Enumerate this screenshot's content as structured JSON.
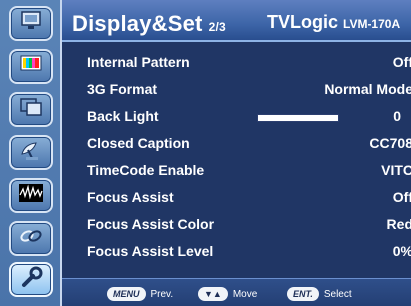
{
  "header": {
    "title": "Display&Set",
    "page": "2/3",
    "brand": "TVLogic",
    "model": "LVM-170A"
  },
  "sidebar": {
    "items": [
      {
        "icon": "monitor-icon",
        "active": false
      },
      {
        "icon": "color-bars-icon",
        "active": false
      },
      {
        "icon": "picture-in-picture-icon",
        "active": false
      },
      {
        "icon": "satellite-dish-icon",
        "active": false
      },
      {
        "icon": "waveform-icon",
        "active": false
      },
      {
        "icon": "link-icon",
        "active": false
      },
      {
        "icon": "wrench-icon",
        "active": true
      }
    ]
  },
  "menu": {
    "items": [
      {
        "label": "Internal Pattern",
        "value": "Off"
      },
      {
        "label": "3G Format",
        "value": "Normal Mode"
      },
      {
        "label": "Back Light",
        "value": "0",
        "progress_percent": 100
      },
      {
        "label": "Closed Caption",
        "value": "CC708"
      },
      {
        "label": "TimeCode Enable",
        "value": "VITC"
      },
      {
        "label": "Focus Assist",
        "value": "Off"
      },
      {
        "label": "Focus Assist Color",
        "value": "Red"
      },
      {
        "label": "Focus Assist Level",
        "value": "0%"
      }
    ]
  },
  "footer": {
    "prev": {
      "key": "MENU",
      "label": "Prev."
    },
    "move": {
      "key": "▼▲",
      "label": "Move"
    },
    "select": {
      "key": "ENT.",
      "label": "Select"
    }
  },
  "colors": {
    "background": "#203665",
    "sidebar": "#4a73a9",
    "topbar": "#3d65a8",
    "text": "#ffffff"
  }
}
